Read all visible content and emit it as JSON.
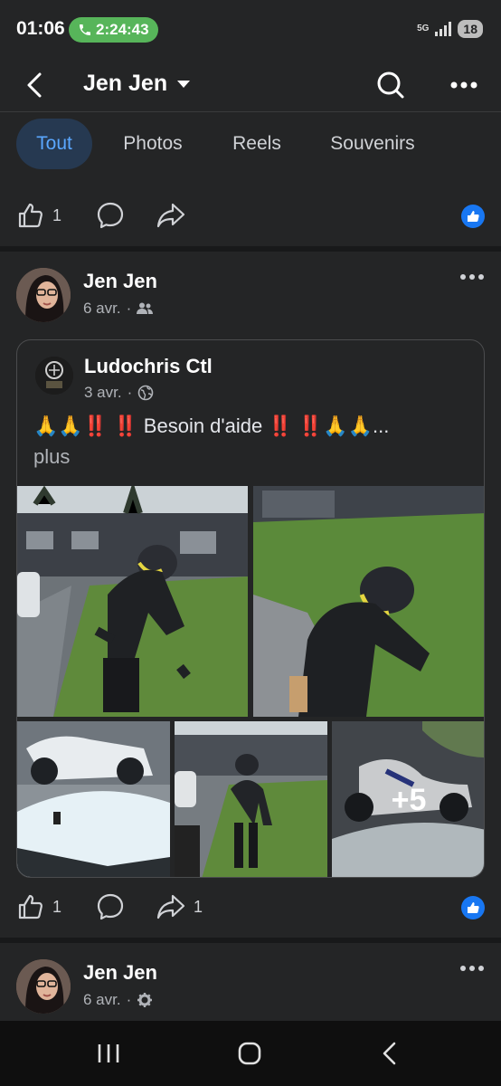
{
  "status": {
    "time": "01:06",
    "call_timer": "2:24:43",
    "network": "5G",
    "battery": "18"
  },
  "appbar": {
    "title": "Jen Jen"
  },
  "tabs": [
    {
      "label": "Tout",
      "active": true
    },
    {
      "label": "Photos",
      "active": false
    },
    {
      "label": "Reels",
      "active": false
    },
    {
      "label": "Souvenirs",
      "active": false
    }
  ],
  "top_actions": {
    "like_count": "1"
  },
  "post1": {
    "author": "Jen Jen",
    "date": "6 avr.",
    "audience_icon": "friends-icon",
    "shared": {
      "author": "Ludochris Ctl",
      "date": "3 avr.",
      "audience_icon": "globe-icon",
      "text": "🙏🙏‼️ ‼️ Besoin d'aide ‼️ ‼️🙏🙏...",
      "more": "plus",
      "extra_photos": "+5"
    },
    "like_count": "1",
    "share_count": "1"
  },
  "post2": {
    "author": "Jen Jen",
    "date": "6 avr.",
    "audience_icon": "gear-icon"
  },
  "colors": {
    "background": "#242526",
    "accent": "#1877f2",
    "call_green": "#57b55a",
    "active_tab_bg": "#263951",
    "active_tab_text": "#5aa7ff"
  }
}
